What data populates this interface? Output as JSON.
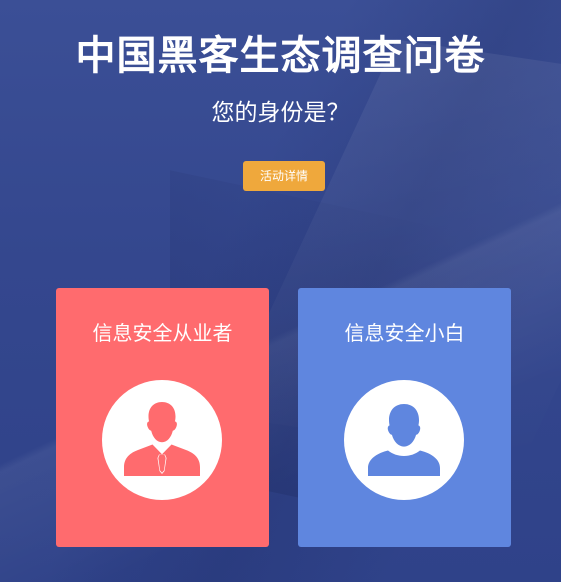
{
  "header": {
    "title": "中国黑客生态调查问卷",
    "subtitle": "您的身份是？"
  },
  "details_button": {
    "label": "活动详情",
    "color": "#efa83c"
  },
  "cards": [
    {
      "label": "信息安全从业者",
      "icon": "professional-user-icon",
      "color": "#ff6b6e"
    },
    {
      "label": "信息安全小白",
      "icon": "user-icon",
      "color": "#5f86df"
    }
  ],
  "theme": {
    "background": "#34478e"
  }
}
